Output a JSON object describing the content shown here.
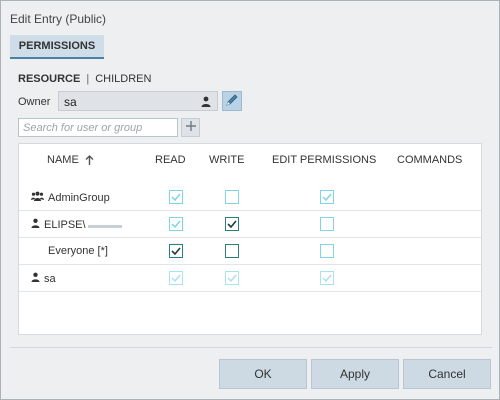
{
  "window": {
    "title": "Edit Entry (Public)"
  },
  "tabs": [
    {
      "label": "PERMISSIONS"
    }
  ],
  "subtabs": {
    "active": "RESOURCE",
    "separator": "|",
    "inactive": "CHILDREN"
  },
  "owner": {
    "label": "Owner",
    "value": "sa"
  },
  "search": {
    "placeholder": "Search for user or group"
  },
  "table": {
    "headers": {
      "name": "NAME",
      "read": "READ",
      "write": "WRITE",
      "edit_permissions": "EDIT PERMISSIONS",
      "commands": "COMMANDS"
    },
    "rows": [
      {
        "name": "AdminGroup",
        "icon": "group-icon",
        "read": "checked-inherited",
        "write": "unchecked",
        "edit": "checked-inherited"
      },
      {
        "name": "ELIPSE\\",
        "icon": "person-icon",
        "read": "checked-inherited",
        "write": "checked",
        "edit": "unchecked"
      },
      {
        "name": "Everyone [*]",
        "icon": "none",
        "read": "checked",
        "write": "unchecked-dark",
        "edit": "unchecked"
      },
      {
        "name": "sa",
        "icon": "person-icon",
        "read": "checked-disabled",
        "write": "checked-disabled",
        "edit": "checked-disabled"
      }
    ]
  },
  "buttons": {
    "ok": "OK",
    "apply": "Apply",
    "cancel": "Cancel"
  },
  "colors": {
    "accent": "#4a7fa6",
    "check_light": "#7ed6e6",
    "check_dark": "#2a7f7a",
    "button_bg": "#cdd9e3"
  }
}
